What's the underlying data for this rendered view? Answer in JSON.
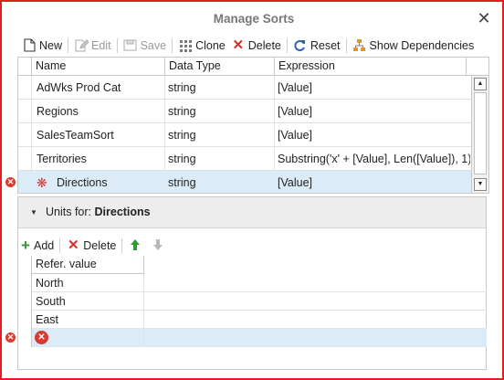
{
  "window": {
    "title": "Manage Sorts",
    "close_glyph": "✕"
  },
  "toolbar": {
    "items": [
      {
        "label": "New",
        "icon": "new-file-icon",
        "enabled": true
      },
      {
        "label": "Edit",
        "icon": "edit-icon",
        "enabled": false
      },
      {
        "label": "Save",
        "icon": "save-icon",
        "enabled": false
      },
      {
        "label": "Clone",
        "icon": "clone-icon",
        "enabled": true
      },
      {
        "label": "Delete",
        "icon": "delete-icon",
        "enabled": true
      },
      {
        "label": "Reset",
        "icon": "reset-icon",
        "enabled": true
      },
      {
        "label": "Show Dependencies",
        "icon": "dependencies-icon",
        "enabled": true
      }
    ]
  },
  "sorts_grid": {
    "columns": [
      "Name",
      "Data Type",
      "Expression"
    ],
    "rows": [
      {
        "name": "AdWks Prod Cat",
        "type": "string",
        "expression": "[Value]"
      },
      {
        "name": "Regions",
        "type": "string",
        "expression": "[Value]"
      },
      {
        "name": "SalesTeamSort",
        "type": "string",
        "expression": "[Value]"
      },
      {
        "name": "Territories",
        "type": "string",
        "expression": "Substring('x' + [Value], Len([Value]), 1)"
      },
      {
        "name": "Directions",
        "type": "string",
        "expression": "[Value]",
        "selected": true,
        "error": true
      }
    ]
  },
  "units_panel": {
    "label_prefix": "Units for:",
    "label_target": "Directions",
    "toolbar": {
      "add": "Add",
      "delete": "Delete"
    },
    "column": "Refer. value",
    "rows": [
      "North",
      "South",
      "East",
      ""
    ]
  },
  "colors": {
    "accent_selection": "#dcebf8",
    "error": "#d83a2f",
    "move_up": "#2e9b2e",
    "delete_red": "#d9302a"
  }
}
